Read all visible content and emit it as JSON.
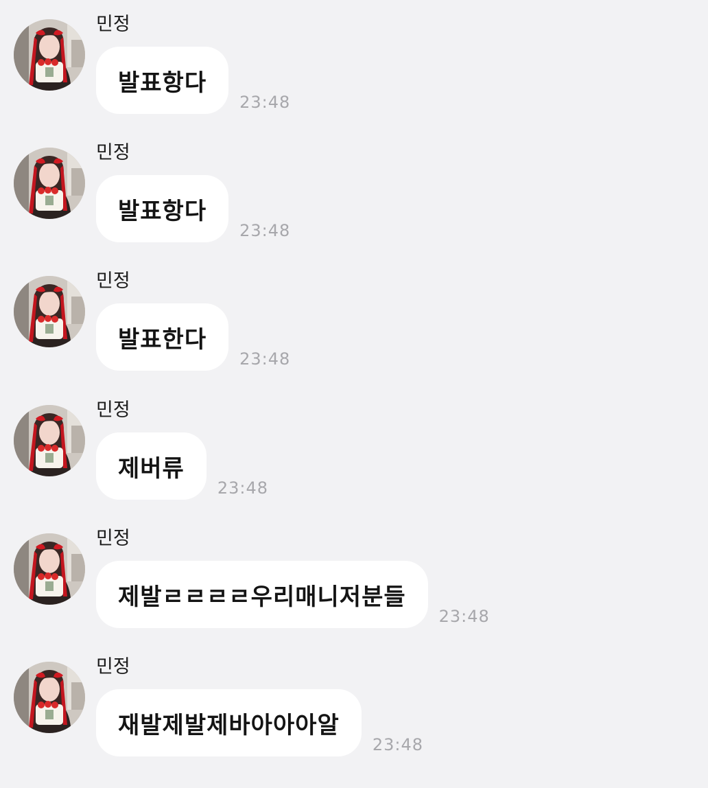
{
  "chat": {
    "messages": [
      {
        "sender": "민정",
        "text": "발표항다",
        "time": "23:48"
      },
      {
        "sender": "민정",
        "text": "발표항다",
        "time": "23:48"
      },
      {
        "sender": "민정",
        "text": "발표한다",
        "time": "23:48"
      },
      {
        "sender": "민정",
        "text": "제버류",
        "time": "23:48"
      },
      {
        "sender": "민정",
        "text": "제발ㄹㄹㄹㄹ우리매니저분들",
        "time": "23:48"
      },
      {
        "sender": "민정",
        "text": "재발제발제바아아아알",
        "time": "23:48"
      }
    ]
  },
  "colors": {
    "background": "#f2f2f4",
    "bubble": "#ffffff",
    "timestamp": "#a7a7ab"
  },
  "icons": {
    "avatar": "profile-photo-avatar-icon"
  }
}
